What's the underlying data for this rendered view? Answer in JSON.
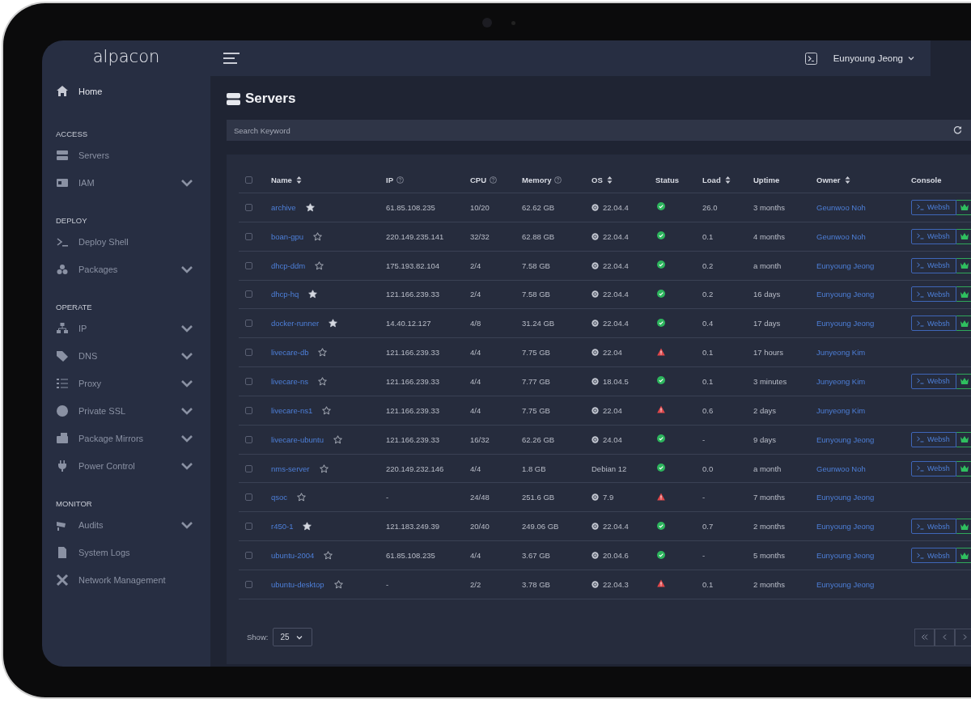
{
  "sidebar": {
    "brand": "alpacon",
    "home": {
      "label": "Home"
    },
    "sections": [
      {
        "title": "ACCESS",
        "items": [
          {
            "label": "Servers",
            "expandable": false
          },
          {
            "label": "IAM",
            "expandable": true
          }
        ]
      },
      {
        "title": "DEPLOY",
        "items": [
          {
            "label": "Deploy Shell",
            "expandable": false
          },
          {
            "label": "Packages",
            "expandable": true
          }
        ]
      },
      {
        "title": "OPERATE",
        "items": [
          {
            "label": "IP",
            "expandable": true
          },
          {
            "label": "DNS",
            "expandable": true
          },
          {
            "label": "Proxy",
            "expandable": true
          },
          {
            "label": "Private SSL",
            "expandable": true
          },
          {
            "label": "Package Mirrors",
            "expandable": true
          },
          {
            "label": "Power Control",
            "expandable": true
          }
        ]
      },
      {
        "title": "MONITOR",
        "items": [
          {
            "label": "Audits",
            "expandable": true
          },
          {
            "label": "System Logs",
            "expandable": false
          },
          {
            "label": "Network Management",
            "expandable": false
          }
        ]
      }
    ]
  },
  "topbar": {
    "user": "Eunyoung Jeong"
  },
  "page": {
    "title": "Servers"
  },
  "search": {
    "placeholder": "Search Keyword"
  },
  "table": {
    "all_checked": false,
    "columns": [
      {
        "label": "Name",
        "sortable": true,
        "help": false
      },
      {
        "label": "IP",
        "sortable": false,
        "help": true
      },
      {
        "label": "CPU",
        "sortable": false,
        "help": true
      },
      {
        "label": "Memory",
        "sortable": false,
        "help": true
      },
      {
        "label": "OS",
        "sortable": true,
        "help": false
      },
      {
        "label": "Status",
        "sortable": false,
        "help": false
      },
      {
        "label": "Load",
        "sortable": true,
        "help": false
      },
      {
        "label": "Uptime",
        "sortable": false,
        "help": false
      },
      {
        "label": "Owner",
        "sortable": true,
        "help": false
      },
      {
        "label": "Console",
        "sortable": false,
        "help": false
      }
    ],
    "rows": [
      {
        "checked": false,
        "name": "archive",
        "favorite": true,
        "ip": "61.85.108.235",
        "cpu": "10/20",
        "memory": "62.62 GB",
        "os_logo": true,
        "os": "22.04.4",
        "status_ok": true,
        "load": "26.0",
        "uptime": "3 months",
        "owner": "Geunwoo Noh",
        "console": "Websh"
      },
      {
        "checked": false,
        "name": "boan-gpu",
        "favorite": false,
        "ip": "220.149.235.141",
        "cpu": "32/32",
        "memory": "62.88 GB",
        "os_logo": true,
        "os": "22.04.4",
        "status_ok": true,
        "load": "0.1",
        "uptime": "4 months",
        "owner": "Geunwoo Noh",
        "console": "Websh"
      },
      {
        "checked": false,
        "name": "dhcp-ddm",
        "favorite": false,
        "ip": "175.193.82.104",
        "cpu": "2/4",
        "memory": "7.58 GB",
        "os_logo": true,
        "os": "22.04.4",
        "status_ok": true,
        "load": "0.2",
        "uptime": "a month",
        "owner": "Eunyoung Jeong",
        "console": "Websh"
      },
      {
        "checked": false,
        "name": "dhcp-hq",
        "favorite": true,
        "ip": "121.166.239.33",
        "cpu": "2/4",
        "memory": "7.58 GB",
        "os_logo": true,
        "os": "22.04.4",
        "status_ok": true,
        "load": "0.2",
        "uptime": "16 days",
        "owner": "Eunyoung Jeong",
        "console": "Websh"
      },
      {
        "checked": false,
        "name": "docker-runner",
        "favorite": true,
        "ip": "14.40.12.127",
        "cpu": "4/8",
        "memory": "31.24 GB",
        "os_logo": true,
        "os": "22.04.4",
        "status_ok": true,
        "load": "0.4",
        "uptime": "17 days",
        "owner": "Eunyoung Jeong",
        "console": "Websh"
      },
      {
        "checked": false,
        "name": "livecare-db",
        "favorite": false,
        "ip": "121.166.239.33",
        "cpu": "4/4",
        "memory": "7.75 GB",
        "os_logo": true,
        "os": "22.04",
        "status_ok": false,
        "load": "0.1",
        "uptime": "17 hours",
        "owner": "Junyeong Kim"
      },
      {
        "checked": false,
        "name": "livecare-ns",
        "favorite": false,
        "ip": "121.166.239.33",
        "cpu": "4/4",
        "memory": "7.77 GB",
        "os_logo": true,
        "os": "18.04.5",
        "status_ok": true,
        "load": "0.1",
        "uptime": "3 minutes",
        "owner": "Junyeong Kim",
        "console": "Websh"
      },
      {
        "checked": false,
        "name": "livecare-ns1",
        "favorite": false,
        "ip": "121.166.239.33",
        "cpu": "4/4",
        "memory": "7.75 GB",
        "os_logo": true,
        "os": "22.04",
        "status_ok": false,
        "load": "0.6",
        "uptime": "2 days",
        "owner": "Junyeong Kim"
      },
      {
        "checked": false,
        "name": "livecare-ubuntu",
        "favorite": false,
        "ip": "121.166.239.33",
        "cpu": "16/32",
        "memory": "62.26 GB",
        "os_logo": true,
        "os": "24.04",
        "status_ok": true,
        "load": "-",
        "uptime": "9 days",
        "owner": "Eunyoung Jeong",
        "console": "Websh"
      },
      {
        "checked": false,
        "name": "nms-server",
        "favorite": false,
        "ip": "220.149.232.146",
        "cpu": "4/4",
        "memory": "1.8 GB",
        "os_logo": false,
        "os": "Debian 12",
        "status_ok": true,
        "load": "0.0",
        "uptime": "a month",
        "owner": "Geunwoo Noh",
        "console": "Websh"
      },
      {
        "checked": false,
        "name": "qsoc",
        "favorite": false,
        "ip": "-",
        "cpu": "24/48",
        "memory": "251.6 GB",
        "os_logo": true,
        "os": "7.9",
        "status_ok": false,
        "load": "-",
        "uptime": "7 months",
        "owner": "Eunyoung Jeong"
      },
      {
        "checked": false,
        "name": "r450-1",
        "favorite": true,
        "ip": "121.183.249.39",
        "cpu": "20/40",
        "memory": "249.06 GB",
        "os_logo": true,
        "os": "22.04.4",
        "status_ok": true,
        "load": "0.7",
        "uptime": "2 months",
        "owner": "Eunyoung Jeong",
        "console": "Websh"
      },
      {
        "checked": false,
        "name": "ubuntu-2004",
        "favorite": false,
        "ip": "61.85.108.235",
        "cpu": "4/4",
        "memory": "3.67 GB",
        "os_logo": true,
        "os": "20.04.6",
        "status_ok": true,
        "load": "-",
        "uptime": "5 months",
        "owner": "Eunyoung Jeong",
        "console": "Websh"
      },
      {
        "checked": false,
        "name": "ubuntu-desktop",
        "favorite": false,
        "ip": "-",
        "cpu": "2/2",
        "memory": "3.78 GB",
        "os_logo": true,
        "os": "22.04.3",
        "status_ok": false,
        "load": "0.1",
        "uptime": "2 months",
        "owner": "Eunyoung Jeong"
      }
    ]
  },
  "pagination": {
    "show_label": "Show:",
    "page_size": "25"
  }
}
